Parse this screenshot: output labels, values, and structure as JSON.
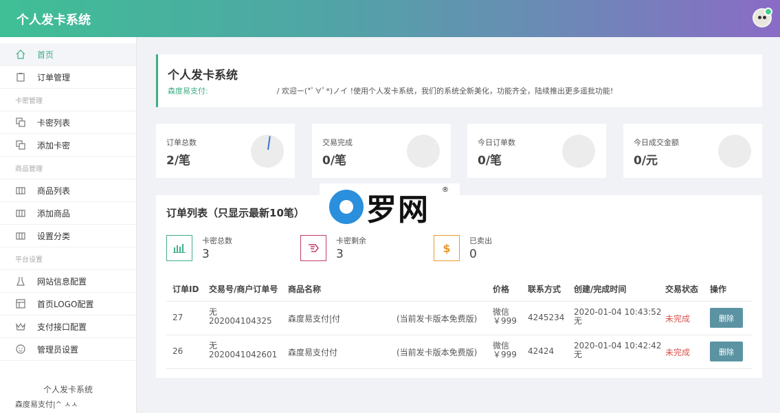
{
  "header": {
    "title": "个人发卡系统"
  },
  "sidebar": {
    "items": [
      {
        "type": "item",
        "label": "首页",
        "icon": "home-icon",
        "active": true
      },
      {
        "type": "item",
        "label": "订单管理",
        "icon": "clipboard-icon"
      },
      {
        "type": "group",
        "label": "卡密管理"
      },
      {
        "type": "item",
        "label": "卡密列表",
        "icon": "copy-icon"
      },
      {
        "type": "item",
        "label": "添加卡密",
        "icon": "copy-icon"
      },
      {
        "type": "group",
        "label": "商品管理"
      },
      {
        "type": "item",
        "label": "商品列表",
        "icon": "book-icon"
      },
      {
        "type": "item",
        "label": "添加商品",
        "icon": "book-icon"
      },
      {
        "type": "item",
        "label": "设置分类",
        "icon": "book-icon"
      },
      {
        "type": "group",
        "label": "平台设置"
      },
      {
        "type": "item",
        "label": "网站信息配置",
        "icon": "flask-icon"
      },
      {
        "type": "item",
        "label": "首页LOGO配置",
        "icon": "layout-icon"
      },
      {
        "type": "item",
        "label": "支付接口配置",
        "icon": "crown-icon"
      },
      {
        "type": "item",
        "label": "管理员设置",
        "icon": "smile-icon"
      }
    ],
    "footer_title": "个人发卡系统",
    "footer_sub": "森度易支付|^ ㅅㅅ"
  },
  "welcome": {
    "title": "个人发卡系统",
    "brand": "森度易支付:",
    "message": "/ 欢迎ー(*ﾟ∀ﾟ*)ノイ !使用个人发卡系统，我们的系统全新美化，功能齐全，陆续推出更多遥批功能!"
  },
  "stats": [
    {
      "label": "订单总数",
      "value": "2/笔",
      "needle": true
    },
    {
      "label": "交易完成",
      "value": "0/笔",
      "needle": false
    },
    {
      "label": "今日订单数",
      "value": "0/笔",
      "needle": false
    },
    {
      "label": "今日成交金额",
      "value": "0/元",
      "needle": false
    }
  ],
  "orders": {
    "title": "订单列表（只显示最新10笔）",
    "mini_stats": [
      {
        "label": "卡密总数",
        "value": "3",
        "icon": "bar-chart-icon",
        "color": "#3fae84"
      },
      {
        "label": "卡密剩余",
        "value": "3",
        "icon": "hand-icon",
        "color": "#c23a6b"
      },
      {
        "label": "已卖出",
        "value": "0",
        "icon": "dollar-icon",
        "color": "#e89a2c"
      }
    ],
    "columns": [
      "订单ID",
      "交易号/商户订单号",
      "商品名称",
      "价格",
      "联系方式",
      "创建/完成时间",
      "交易状态",
      "操作"
    ],
    "rows": [
      {
        "id": "27",
        "trade_no": "无",
        "order_no": "202004104325",
        "product": "森度易支付|付",
        "product_note": "(当前发卡版本免费版)",
        "pay": "微信",
        "price": "￥999",
        "contact": "4245234",
        "created": "2020-01-04 10:43:52",
        "finished": "无",
        "status": "未完成",
        "action": "删除"
      },
      {
        "id": "26",
        "trade_no": "无",
        "order_no": "2020041042601",
        "product": "森度易支付付",
        "product_note": "(当前发卡版本免费版)",
        "pay": "微信",
        "price": "￥999",
        "contact": "42424",
        "created": "2020-01-04 10:42:42",
        "finished": "无",
        "status": "未完成",
        "action": "删除"
      }
    ]
  },
  "watermark": {
    "text": "罗网",
    "reg": "®"
  }
}
